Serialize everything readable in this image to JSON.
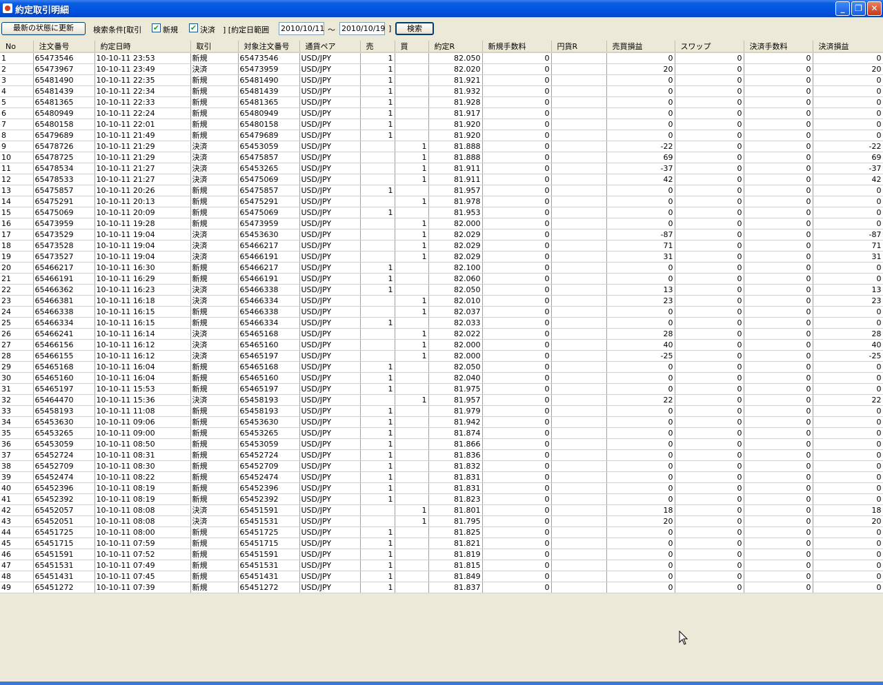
{
  "window": {
    "title": "約定取引明細"
  },
  "toolbar": {
    "refresh_label": "最新の状態に更新",
    "search_cond_label": "検索条件[取引",
    "new_label": "新規",
    "new_checked": true,
    "settle_label": "決済",
    "settle_checked": true,
    "range_label": "] [約定日範囲",
    "date_from": "2010/10/11",
    "tilde": "～",
    "date_to": "2010/10/19",
    "range_close": "]",
    "search_label": "検索"
  },
  "table": {
    "columns": [
      "No",
      "注文番号",
      "約定日時",
      "取引",
      "対象注文番号",
      "通貨ペア",
      "売",
      "買",
      "約定R",
      "新規手数料",
      "円貨R",
      "売買損益",
      "スワップ",
      "決済手数料",
      "決済損益"
    ],
    "rows": [
      [
        "1",
        "65473546",
        "10-10-11 23:53",
        "新規",
        "65473546",
        "USD/JPY",
        "1",
        "",
        "82.050",
        "0",
        "",
        "0",
        "0",
        "0",
        "0"
      ],
      [
        "2",
        "65473967",
        "10-10-11 23:49",
        "決済",
        "65473959",
        "USD/JPY",
        "1",
        "",
        "82.020",
        "0",
        "",
        "20",
        "0",
        "0",
        "20"
      ],
      [
        "3",
        "65481490",
        "10-10-11 22:35",
        "新規",
        "65481490",
        "USD/JPY",
        "1",
        "",
        "81.921",
        "0",
        "",
        "0",
        "0",
        "0",
        "0"
      ],
      [
        "4",
        "65481439",
        "10-10-11 22:34",
        "新規",
        "65481439",
        "USD/JPY",
        "1",
        "",
        "81.932",
        "0",
        "",
        "0",
        "0",
        "0",
        "0"
      ],
      [
        "5",
        "65481365",
        "10-10-11 22:33",
        "新規",
        "65481365",
        "USD/JPY",
        "1",
        "",
        "81.928",
        "0",
        "",
        "0",
        "0",
        "0",
        "0"
      ],
      [
        "6",
        "65480949",
        "10-10-11 22:24",
        "新規",
        "65480949",
        "USD/JPY",
        "1",
        "",
        "81.917",
        "0",
        "",
        "0",
        "0",
        "0",
        "0"
      ],
      [
        "7",
        "65480158",
        "10-10-11 22:01",
        "新規",
        "65480158",
        "USD/JPY",
        "1",
        "",
        "81.920",
        "0",
        "",
        "0",
        "0",
        "0",
        "0"
      ],
      [
        "8",
        "65479689",
        "10-10-11 21:49",
        "新規",
        "65479689",
        "USD/JPY",
        "1",
        "",
        "81.920",
        "0",
        "",
        "0",
        "0",
        "0",
        "0"
      ],
      [
        "9",
        "65478726",
        "10-10-11 21:29",
        "決済",
        "65453059",
        "USD/JPY",
        "",
        "1",
        "81.888",
        "0",
        "",
        "-22",
        "0",
        "0",
        "-22"
      ],
      [
        "10",
        "65478725",
        "10-10-11 21:29",
        "決済",
        "65475857",
        "USD/JPY",
        "",
        "1",
        "81.888",
        "0",
        "",
        "69",
        "0",
        "0",
        "69"
      ],
      [
        "11",
        "65478534",
        "10-10-11 21:27",
        "決済",
        "65453265",
        "USD/JPY",
        "",
        "1",
        "81.911",
        "0",
        "",
        "-37",
        "0",
        "0",
        "-37"
      ],
      [
        "12",
        "65478533",
        "10-10-11 21:27",
        "決済",
        "65475069",
        "USD/JPY",
        "",
        "1",
        "81.911",
        "0",
        "",
        "42",
        "0",
        "0",
        "42"
      ],
      [
        "13",
        "65475857",
        "10-10-11 20:26",
        "新規",
        "65475857",
        "USD/JPY",
        "1",
        "",
        "81.957",
        "0",
        "",
        "0",
        "0",
        "0",
        "0"
      ],
      [
        "14",
        "65475291",
        "10-10-11 20:13",
        "新規",
        "65475291",
        "USD/JPY",
        "",
        "1",
        "81.978",
        "0",
        "",
        "0",
        "0",
        "0",
        "0"
      ],
      [
        "15",
        "65475069",
        "10-10-11 20:09",
        "新規",
        "65475069",
        "USD/JPY",
        "1",
        "",
        "81.953",
        "0",
        "",
        "0",
        "0",
        "0",
        "0"
      ],
      [
        "16",
        "65473959",
        "10-10-11 19:28",
        "新規",
        "65473959",
        "USD/JPY",
        "",
        "1",
        "82.000",
        "0",
        "",
        "0",
        "0",
        "0",
        "0"
      ],
      [
        "17",
        "65473529",
        "10-10-11 19:04",
        "決済",
        "65453630",
        "USD/JPY",
        "",
        "1",
        "82.029",
        "0",
        "",
        "-87",
        "0",
        "0",
        "-87"
      ],
      [
        "18",
        "65473528",
        "10-10-11 19:04",
        "決済",
        "65466217",
        "USD/JPY",
        "",
        "1",
        "82.029",
        "0",
        "",
        "71",
        "0",
        "0",
        "71"
      ],
      [
        "19",
        "65473527",
        "10-10-11 19:04",
        "決済",
        "65466191",
        "USD/JPY",
        "",
        "1",
        "82.029",
        "0",
        "",
        "31",
        "0",
        "0",
        "31"
      ],
      [
        "20",
        "65466217",
        "10-10-11 16:30",
        "新規",
        "65466217",
        "USD/JPY",
        "1",
        "",
        "82.100",
        "0",
        "",
        "0",
        "0",
        "0",
        "0"
      ],
      [
        "21",
        "65466191",
        "10-10-11 16:29",
        "新規",
        "65466191",
        "USD/JPY",
        "1",
        "",
        "82.060",
        "0",
        "",
        "0",
        "0",
        "0",
        "0"
      ],
      [
        "22",
        "65466362",
        "10-10-11 16:23",
        "決済",
        "65466338",
        "USD/JPY",
        "1",
        "",
        "82.050",
        "0",
        "",
        "13",
        "0",
        "0",
        "13"
      ],
      [
        "23",
        "65466381",
        "10-10-11 16:18",
        "決済",
        "65466334",
        "USD/JPY",
        "",
        "1",
        "82.010",
        "0",
        "",
        "23",
        "0",
        "0",
        "23"
      ],
      [
        "24",
        "65466338",
        "10-10-11 16:15",
        "新規",
        "65466338",
        "USD/JPY",
        "",
        "1",
        "82.037",
        "0",
        "",
        "0",
        "0",
        "0",
        "0"
      ],
      [
        "25",
        "65466334",
        "10-10-11 16:15",
        "新規",
        "65466334",
        "USD/JPY",
        "1",
        "",
        "82.033",
        "0",
        "",
        "0",
        "0",
        "0",
        "0"
      ],
      [
        "26",
        "65466241",
        "10-10-11 16:14",
        "決済",
        "65465168",
        "USD/JPY",
        "",
        "1",
        "82.022",
        "0",
        "",
        "28",
        "0",
        "0",
        "28"
      ],
      [
        "27",
        "65466156",
        "10-10-11 16:12",
        "決済",
        "65465160",
        "USD/JPY",
        "",
        "1",
        "82.000",
        "0",
        "",
        "40",
        "0",
        "0",
        "40"
      ],
      [
        "28",
        "65466155",
        "10-10-11 16:12",
        "決済",
        "65465197",
        "USD/JPY",
        "",
        "1",
        "82.000",
        "0",
        "",
        "-25",
        "0",
        "0",
        "-25"
      ],
      [
        "29",
        "65465168",
        "10-10-11 16:04",
        "新規",
        "65465168",
        "USD/JPY",
        "1",
        "",
        "82.050",
        "0",
        "",
        "0",
        "0",
        "0",
        "0"
      ],
      [
        "30",
        "65465160",
        "10-10-11 16:04",
        "新規",
        "65465160",
        "USD/JPY",
        "1",
        "",
        "82.040",
        "0",
        "",
        "0",
        "0",
        "0",
        "0"
      ],
      [
        "31",
        "65465197",
        "10-10-11 15:53",
        "新規",
        "65465197",
        "USD/JPY",
        "1",
        "",
        "81.975",
        "0",
        "",
        "0",
        "0",
        "0",
        "0"
      ],
      [
        "32",
        "65464470",
        "10-10-11 15:36",
        "決済",
        "65458193",
        "USD/JPY",
        "",
        "1",
        "81.957",
        "0",
        "",
        "22",
        "0",
        "0",
        "22"
      ],
      [
        "33",
        "65458193",
        "10-10-11 11:08",
        "新規",
        "65458193",
        "USD/JPY",
        "1",
        "",
        "81.979",
        "0",
        "",
        "0",
        "0",
        "0",
        "0"
      ],
      [
        "34",
        "65453630",
        "10-10-11 09:06",
        "新規",
        "65453630",
        "USD/JPY",
        "1",
        "",
        "81.942",
        "0",
        "",
        "0",
        "0",
        "0",
        "0"
      ],
      [
        "35",
        "65453265",
        "10-10-11 09:00",
        "新規",
        "65453265",
        "USD/JPY",
        "1",
        "",
        "81.874",
        "0",
        "",
        "0",
        "0",
        "0",
        "0"
      ],
      [
        "36",
        "65453059",
        "10-10-11 08:50",
        "新規",
        "65453059",
        "USD/JPY",
        "1",
        "",
        "81.866",
        "0",
        "",
        "0",
        "0",
        "0",
        "0"
      ],
      [
        "37",
        "65452724",
        "10-10-11 08:31",
        "新規",
        "65452724",
        "USD/JPY",
        "1",
        "",
        "81.836",
        "0",
        "",
        "0",
        "0",
        "0",
        "0"
      ],
      [
        "38",
        "65452709",
        "10-10-11 08:30",
        "新規",
        "65452709",
        "USD/JPY",
        "1",
        "",
        "81.832",
        "0",
        "",
        "0",
        "0",
        "0",
        "0"
      ],
      [
        "39",
        "65452474",
        "10-10-11 08:22",
        "新規",
        "65452474",
        "USD/JPY",
        "1",
        "",
        "81.831",
        "0",
        "",
        "0",
        "0",
        "0",
        "0"
      ],
      [
        "40",
        "65452396",
        "10-10-11 08:19",
        "新規",
        "65452396",
        "USD/JPY",
        "1",
        "",
        "81.831",
        "0",
        "",
        "0",
        "0",
        "0",
        "0"
      ],
      [
        "41",
        "65452392",
        "10-10-11 08:19",
        "新規",
        "65452392",
        "USD/JPY",
        "1",
        "",
        "81.823",
        "0",
        "",
        "0",
        "0",
        "0",
        "0"
      ],
      [
        "42",
        "65452057",
        "10-10-11 08:08",
        "決済",
        "65451591",
        "USD/JPY",
        "",
        "1",
        "81.801",
        "0",
        "",
        "18",
        "0",
        "0",
        "18"
      ],
      [
        "43",
        "65452051",
        "10-10-11 08:08",
        "決済",
        "65451531",
        "USD/JPY",
        "",
        "1",
        "81.795",
        "0",
        "",
        "20",
        "0",
        "0",
        "20"
      ],
      [
        "44",
        "65451725",
        "10-10-11 08:00",
        "新規",
        "65451725",
        "USD/JPY",
        "1",
        "",
        "81.825",
        "0",
        "",
        "0",
        "0",
        "0",
        "0"
      ],
      [
        "45",
        "65451715",
        "10-10-11 07:59",
        "新規",
        "65451715",
        "USD/JPY",
        "1",
        "",
        "81.821",
        "0",
        "",
        "0",
        "0",
        "0",
        "0"
      ],
      [
        "46",
        "65451591",
        "10-10-11 07:52",
        "新規",
        "65451591",
        "USD/JPY",
        "1",
        "",
        "81.819",
        "0",
        "",
        "0",
        "0",
        "0",
        "0"
      ],
      [
        "47",
        "65451531",
        "10-10-11 07:49",
        "新規",
        "65451531",
        "USD/JPY",
        "1",
        "",
        "81.815",
        "0",
        "",
        "0",
        "0",
        "0",
        "0"
      ],
      [
        "48",
        "65451431",
        "10-10-11 07:45",
        "新規",
        "65451431",
        "USD/JPY",
        "1",
        "",
        "81.849",
        "0",
        "",
        "0",
        "0",
        "0",
        "0"
      ],
      [
        "49",
        "65451272",
        "10-10-11 07:39",
        "新規",
        "65451272",
        "USD/JPY",
        "1",
        "",
        "81.837",
        "0",
        "",
        "0",
        "0",
        "0",
        "0"
      ]
    ]
  }
}
